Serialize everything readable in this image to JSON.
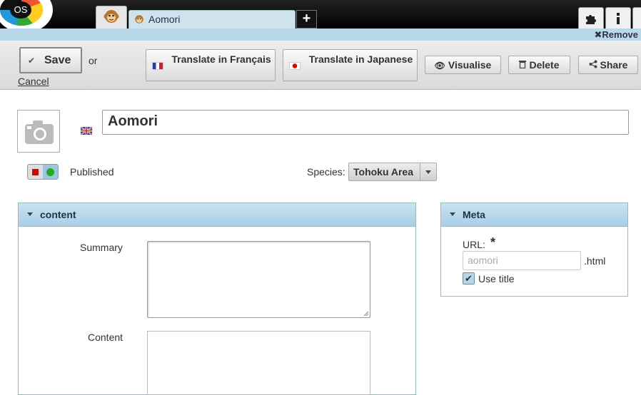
{
  "header": {
    "tabs": [
      {
        "label": "Aomori"
      }
    ],
    "add_tab": "+",
    "remove_label": "Remove"
  },
  "logo": {
    "text": "OS"
  },
  "toolbar": {
    "save_label": "Save",
    "or_text": "or",
    "cancel_label": "Cancel",
    "translate_fr": "Translate in Français",
    "translate_ja": "Translate in Japanese",
    "visualise_label": "Visualise",
    "delete_label": "Delete",
    "share_label": "Share"
  },
  "page": {
    "title_value": "Aomori",
    "status_label": "Published",
    "species_label": "Species:",
    "species_value": "Tohoku Area"
  },
  "content_panel": {
    "title": "content",
    "summary_label": "Summary",
    "content_label": "Content"
  },
  "meta_panel": {
    "title": "Meta",
    "url_label": "URL:",
    "url_required": "*",
    "url_placeholder": "aomori",
    "url_ext": ".html",
    "use_title_label": "Use title",
    "use_title_checked": true
  },
  "colors": {
    "accent": "#b9d9ea",
    "toolbar_bg": "#e2e2e2",
    "topbar": "#111111"
  }
}
